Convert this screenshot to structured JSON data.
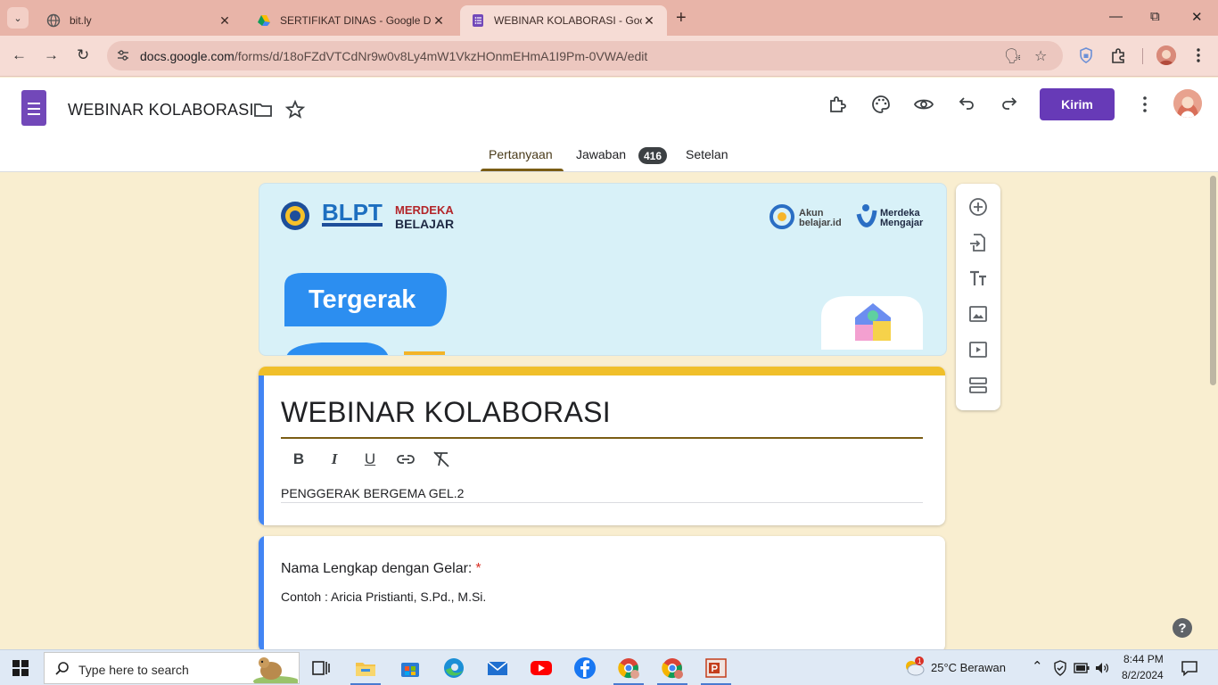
{
  "browser": {
    "tabs": [
      {
        "title": "bit.ly",
        "close": "✕"
      },
      {
        "title": "SERTIFIKAT DINAS - Google Drive",
        "close": "✕"
      },
      {
        "title": "WEBINAR KOLABORASI - Google Forms",
        "close": "✕",
        "active": true
      }
    ],
    "new_tab": "+",
    "url_host": "docs.google.com",
    "url_path": "/forms/d/18oFZdVTCdNr9w0v8Ly4mW1VkzHOnmEHmA1I9Pm-0VWA/edit"
  },
  "forms": {
    "doc_title": "WEBINAR KOLABORASI",
    "send_label": "Kirim",
    "tabs": {
      "questions": "Pertanyaan",
      "responses": "Jawaban",
      "responses_count": "416",
      "settings": "Setelan"
    }
  },
  "banner": {
    "blpt": "BLPT",
    "merdeka_belajar_1": "MERDEKA",
    "merdeka_belajar_2": "BELAJAR",
    "akun_1": "Akun",
    "akun_2": "belajar.id",
    "mengajar_1": "Merdeka",
    "mengajar_2": "Mengajar",
    "tergerak": "Tergerak"
  },
  "title_card": {
    "title": "WEBINAR KOLABORASI",
    "description": "PENGGERAK BERGEMA GEL.2",
    "format_buttons": {
      "bold": "B",
      "italic": "I",
      "underline": "U"
    }
  },
  "question": {
    "title": "Nama Lengkap dengan Gelar:",
    "required_mark": "*",
    "help": "Contoh : Aricia Pristianti, S.Pd., M.Si."
  },
  "help_fab": "?",
  "taskbar": {
    "search_placeholder": "Type here to search",
    "weather": "25°C  Berawan",
    "time": "8:44 PM",
    "date": "8/2/2024",
    "weather_badge": "1"
  },
  "colors": {
    "accent": "#673ab7",
    "theme_bar": "#f0bf2a",
    "background": "#f9eed0",
    "tab_strip": "#e8b4a8"
  }
}
